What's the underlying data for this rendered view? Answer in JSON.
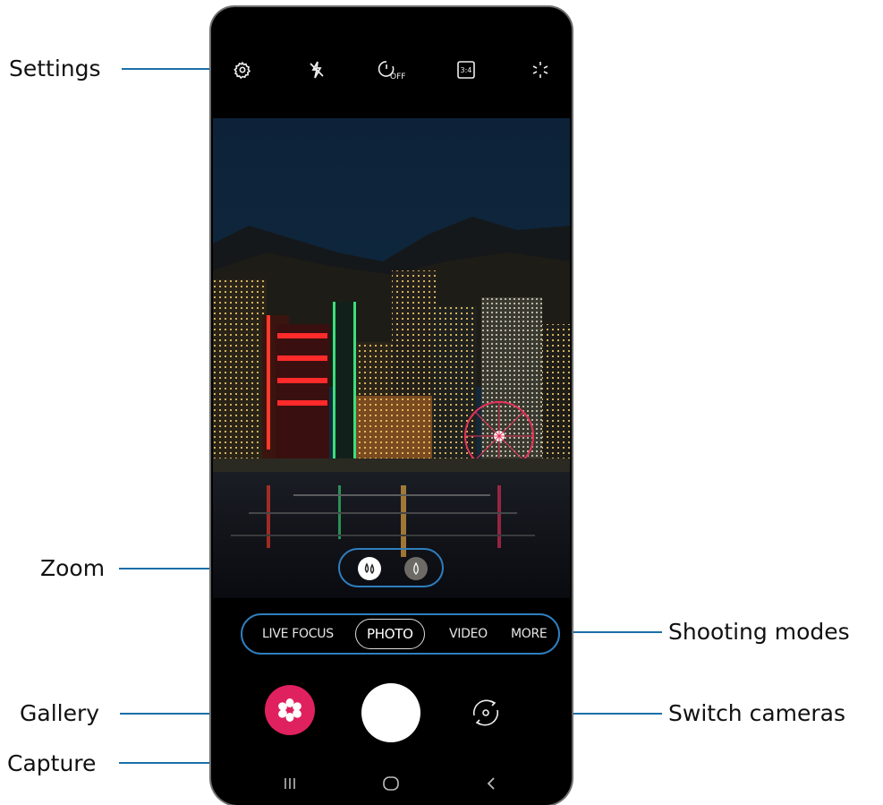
{
  "callouts": {
    "settings": "Settings",
    "zoom": "Zoom",
    "gallery": "Gallery",
    "capture": "Capture",
    "shooting_modes": "Shooting modes",
    "switch_cameras": "Switch cameras"
  },
  "camera": {
    "timer_label": "OFF",
    "ratio_label": "3:4",
    "modes": [
      "LIVE FOCUS",
      "PHOTO",
      "VIDEO",
      "MORE"
    ],
    "active_mode": "PHOTO"
  },
  "colors": {
    "accent": "#2f7fbf",
    "gallery": "#e0215f",
    "phone": "#000000"
  },
  "icons": [
    "gear-icon",
    "flash-off-icon",
    "timer-off-icon",
    "aspect-ratio-icon",
    "filter-sparkle-icon",
    "zoom-wide-icon",
    "zoom-normal-icon",
    "gallery-flower-icon",
    "switch-camera-icon",
    "recents-icon",
    "home-icon",
    "back-icon"
  ]
}
